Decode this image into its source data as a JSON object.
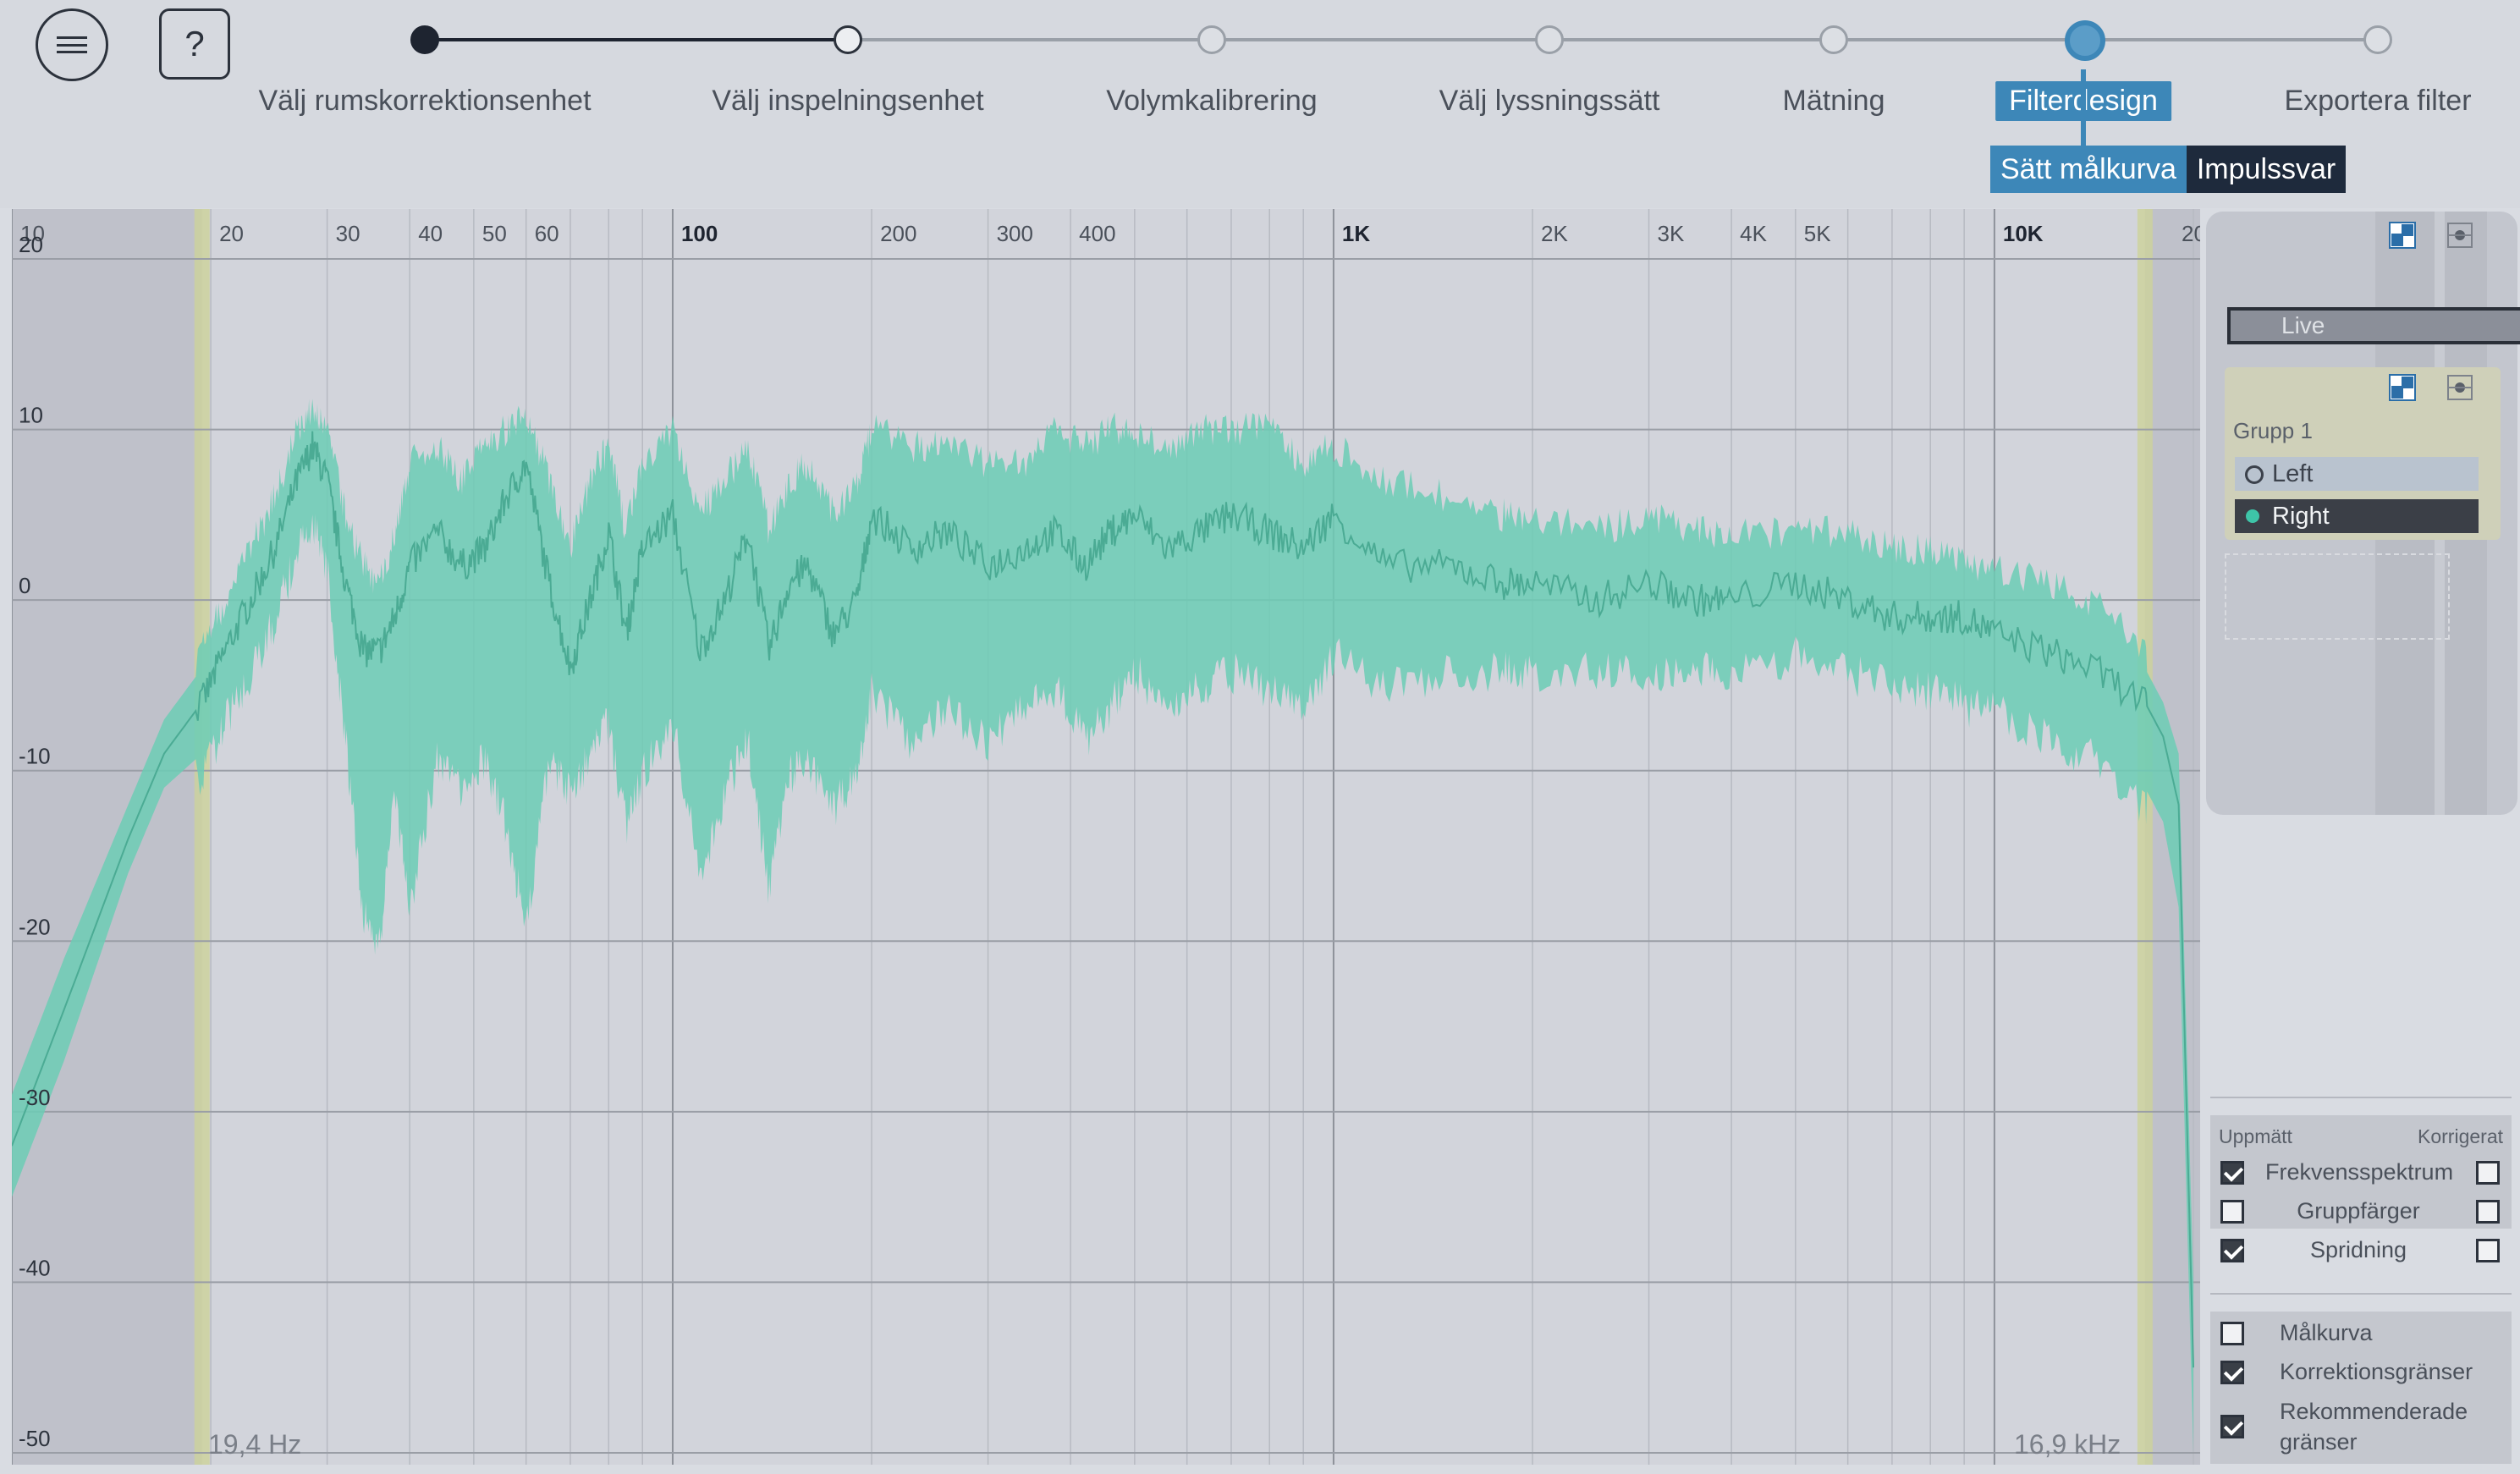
{
  "toolbar": {
    "menu_label": "Meny",
    "help_label": "?"
  },
  "steps": [
    {
      "label": "Välj rumskorrektionsenhet",
      "state": "done"
    },
    {
      "label": "Välj inspelningsenhet",
      "state": "prev"
    },
    {
      "label": "Volymkalibrering",
      "state": "todo"
    },
    {
      "label": "Välj lyssningssätt",
      "state": "todo"
    },
    {
      "label": "Mätning",
      "state": "todo"
    },
    {
      "label": "Filterdesign",
      "state": "active"
    },
    {
      "label": "Exportera filter",
      "state": "todo"
    }
  ],
  "subtabs": {
    "target": "Sätt målkurva",
    "impulse": "Impulssvar"
  },
  "chart_data": {
    "type": "area",
    "title": "",
    "xlabel": "",
    "ylabel": "",
    "x_scale": "log",
    "xlim": [
      10,
      20000
    ],
    "ylim": [
      -50,
      20
    ],
    "x_tick_labels": [
      "10",
      "20",
      "30",
      "40",
      "50",
      "60",
      "100",
      "200",
      "300",
      "400",
      "1K",
      "2K",
      "3K",
      "4K",
      "5K",
      "10K",
      "20"
    ],
    "y_tick_labels": [
      "20",
      "10",
      "0",
      "-10",
      "-20",
      "-30",
      "-40",
      "-50"
    ],
    "correction_limits": {
      "low": "19,4 Hz",
      "high": "16,9 kHz"
    },
    "series": [
      {
        "name": "Right",
        "color": "#6ccdb5",
        "x": [
          10,
          12,
          15,
          17,
          19.4,
          21,
          23,
          25,
          27,
          28.5,
          30,
          32,
          34,
          36,
          38,
          40,
          44,
          48,
          52,
          56,
          60,
          65,
          70,
          75,
          80,
          85,
          90,
          100,
          110,
          120,
          130,
          140,
          150,
          160,
          175,
          190,
          200,
          230,
          260,
          300,
          340,
          380,
          420,
          460,
          500,
          560,
          630,
          700,
          800,
          900,
          1000,
          1200,
          1500,
          1800,
          2000,
          2500,
          3000,
          3500,
          4000,
          5000,
          6000,
          7000,
          8000,
          9000,
          10000,
          12000,
          14000,
          16900,
          18000,
          19000,
          20000
        ],
        "mean": [
          -32,
          -24,
          -14,
          -9,
          -6,
          -3,
          0,
          3,
          7,
          9,
          7,
          1,
          -3,
          -3,
          -1,
          2,
          4,
          2,
          3,
          6,
          8,
          1,
          -4,
          0,
          4,
          -2,
          3,
          5,
          -3,
          0,
          4,
          -3,
          1,
          2,
          -2,
          0,
          5,
          3,
          4,
          2,
          3,
          4,
          2,
          4,
          5,
          3,
          4,
          5,
          4,
          3,
          5,
          2,
          2,
          1,
          1,
          0,
          1,
          0,
          0,
          1,
          0,
          -1,
          -1,
          -1,
          -2,
          -3,
          -4,
          -6,
          -8,
          -12,
          -45
        ],
        "upper": [
          -29,
          -21,
          -12,
          -7,
          -4,
          -1,
          2,
          5,
          9,
          10,
          9,
          4,
          1,
          0,
          3,
          7,
          8,
          6,
          8,
          9,
          10,
          6,
          2,
          6,
          8,
          3,
          7,
          9,
          4,
          6,
          8,
          3,
          6,
          7,
          4,
          6,
          9,
          8,
          8,
          7,
          7,
          9,
          8,
          9,
          9,
          8,
          9,
          9,
          9,
          7,
          8,
          6,
          5,
          4,
          4,
          3,
          4,
          3,
          3,
          3,
          3,
          2,
          2,
          1,
          1,
          0,
          -1,
          -4,
          -6,
          -9,
          -40
        ],
        "lower": [
          -35,
          -27,
          -16,
          -11,
          -9,
          -6,
          -3,
          0,
          4,
          6,
          3,
          -7,
          -17,
          -19,
          -10,
          -17,
          -8,
          -10,
          -8,
          -12,
          -18,
          -8,
          -10,
          -8,
          -6,
          -12,
          -9,
          -6,
          -15,
          -10,
          -7,
          -16,
          -9,
          -8,
          -11,
          -9,
          -4,
          -7,
          -5,
          -7,
          -5,
          -4,
          -7,
          -5,
          -3,
          -5,
          -4,
          -3,
          -4,
          -5,
          -2,
          -4,
          -3,
          -3,
          -3,
          -3,
          -3,
          -3,
          -3,
          -2,
          -3,
          -4,
          -4,
          -5,
          -5,
          -7,
          -8,
          -11,
          -13,
          -18,
          -50
        ]
      }
    ]
  },
  "side": {
    "live_label": "Live",
    "group_title": "Grupp 1",
    "channels": [
      "Left",
      "Right"
    ]
  },
  "options": {
    "header_measured": "Uppmätt",
    "header_corrected": "Korrigerat",
    "rows": [
      {
        "label": "Frekvensspektrum",
        "measured": true,
        "corrected": false
      },
      {
        "label": "Gruppfärger",
        "measured": false,
        "corrected": false
      },
      {
        "label": "Spridning",
        "measured": true,
        "corrected": false
      }
    ],
    "extras": [
      {
        "label": "Målkurva",
        "checked": false
      },
      {
        "label": "Korrektionsgränser",
        "checked": true
      },
      {
        "label": "Rekommenderade gränser",
        "checked": true
      }
    ]
  },
  "colors": {
    "accent": "#3d87b8",
    "curve": "#6ccdb5",
    "limit_band": "#cdd29a",
    "dark": "#1e2430"
  }
}
